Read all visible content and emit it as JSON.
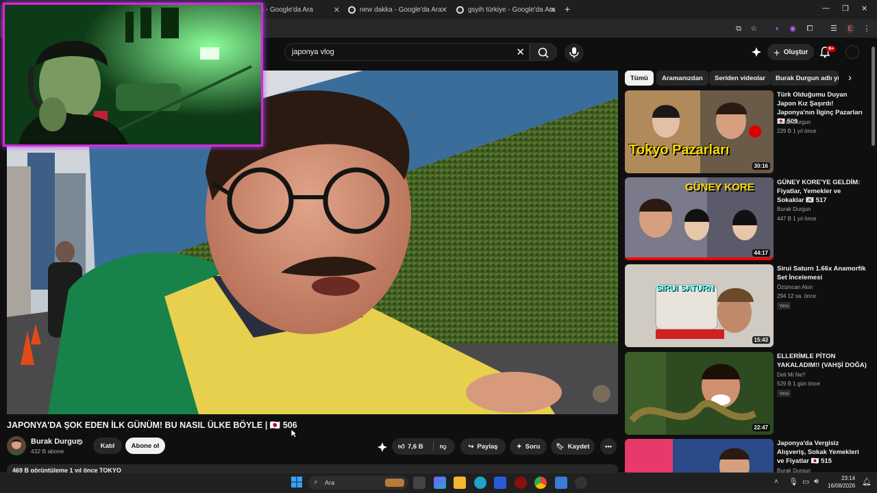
{
  "browser": {
    "tabs": [
      {
        "title": "ş - Google'da Ara"
      },
      {
        "title": "new dakka - Google'da Ara"
      },
      {
        "title": "gsyih türkiye - Google'da Ara"
      }
    ],
    "new_tab": "+"
  },
  "header": {
    "search_value": "japonya vlog",
    "create_label": "Oluştur",
    "notif_count": "9+"
  },
  "video": {
    "title": "JAPONYA'DA ŞOK EDEN İLK GÜNÜM! BU NASIL ÜLKE BÖYLE | 🇯🇵 506",
    "channel": "Burak Durgun",
    "subscribers": "432 B abone",
    "join_label": "Katıl",
    "subscribe_label": "Abone ol",
    "likes": "7,6 B",
    "share_label": "Paylaş",
    "ask_label": "Soru",
    "save_label": "Kaydet",
    "description_line": "469 B görüntüleme  1 yıl önce  TOKYO"
  },
  "chips": [
    "Tümü",
    "Aramanızdan",
    "Seriden videolar",
    "Burak Durgun adlı yük"
  ],
  "recommendations": [
    {
      "title": "Türk Olduğumu Duyan Japon Kız Şaşırdı! Japonya'nın İlginç Pazarları 🇯🇵 509",
      "channel": "Burak Durgun",
      "meta": "229 B  1 yıl önce",
      "duration": "30:16",
      "thumb_text": "Tokyo Pazarları",
      "new": ""
    },
    {
      "title": "GÜNEY KORE'YE GELDİM: Fiyatlar, Yemekler ve Sokaklar 🇰🇷 517",
      "channel": "Burak Durgun",
      "meta": "447 B  1 yıl önce",
      "duration": "44:17",
      "thumb_text": "GÜNEY KORE",
      "new": ""
    },
    {
      "title": "Sirui Saturn 1.66x Anamorfik Set İncelemesi",
      "channel": "Özümcan Akın",
      "meta": "294  12 sa. önce",
      "duration": "15:43",
      "thumb_text": "SIRUI SATURN",
      "new": "Yeni"
    },
    {
      "title": "ELLERİMLE PİTON YAKALADIM!! (VAHŞİ DOĞA)",
      "channel": "Deli Mi Ne?",
      "meta": "529 B  1 gün önce",
      "duration": "22:47",
      "thumb_text": "",
      "new": "Yeni"
    },
    {
      "title": "Japonya'da Vergisiz Alışveriş, Sokak Yemekleri ve Fiyatlar 🇯🇵 515",
      "channel": "Burak Durgun",
      "meta": "",
      "duration": "",
      "thumb_text": "",
      "new": ""
    }
  ],
  "taskbar": {
    "search_placeholder": "Ara",
    "time": "23:14",
    "date": "16/08/2026"
  }
}
